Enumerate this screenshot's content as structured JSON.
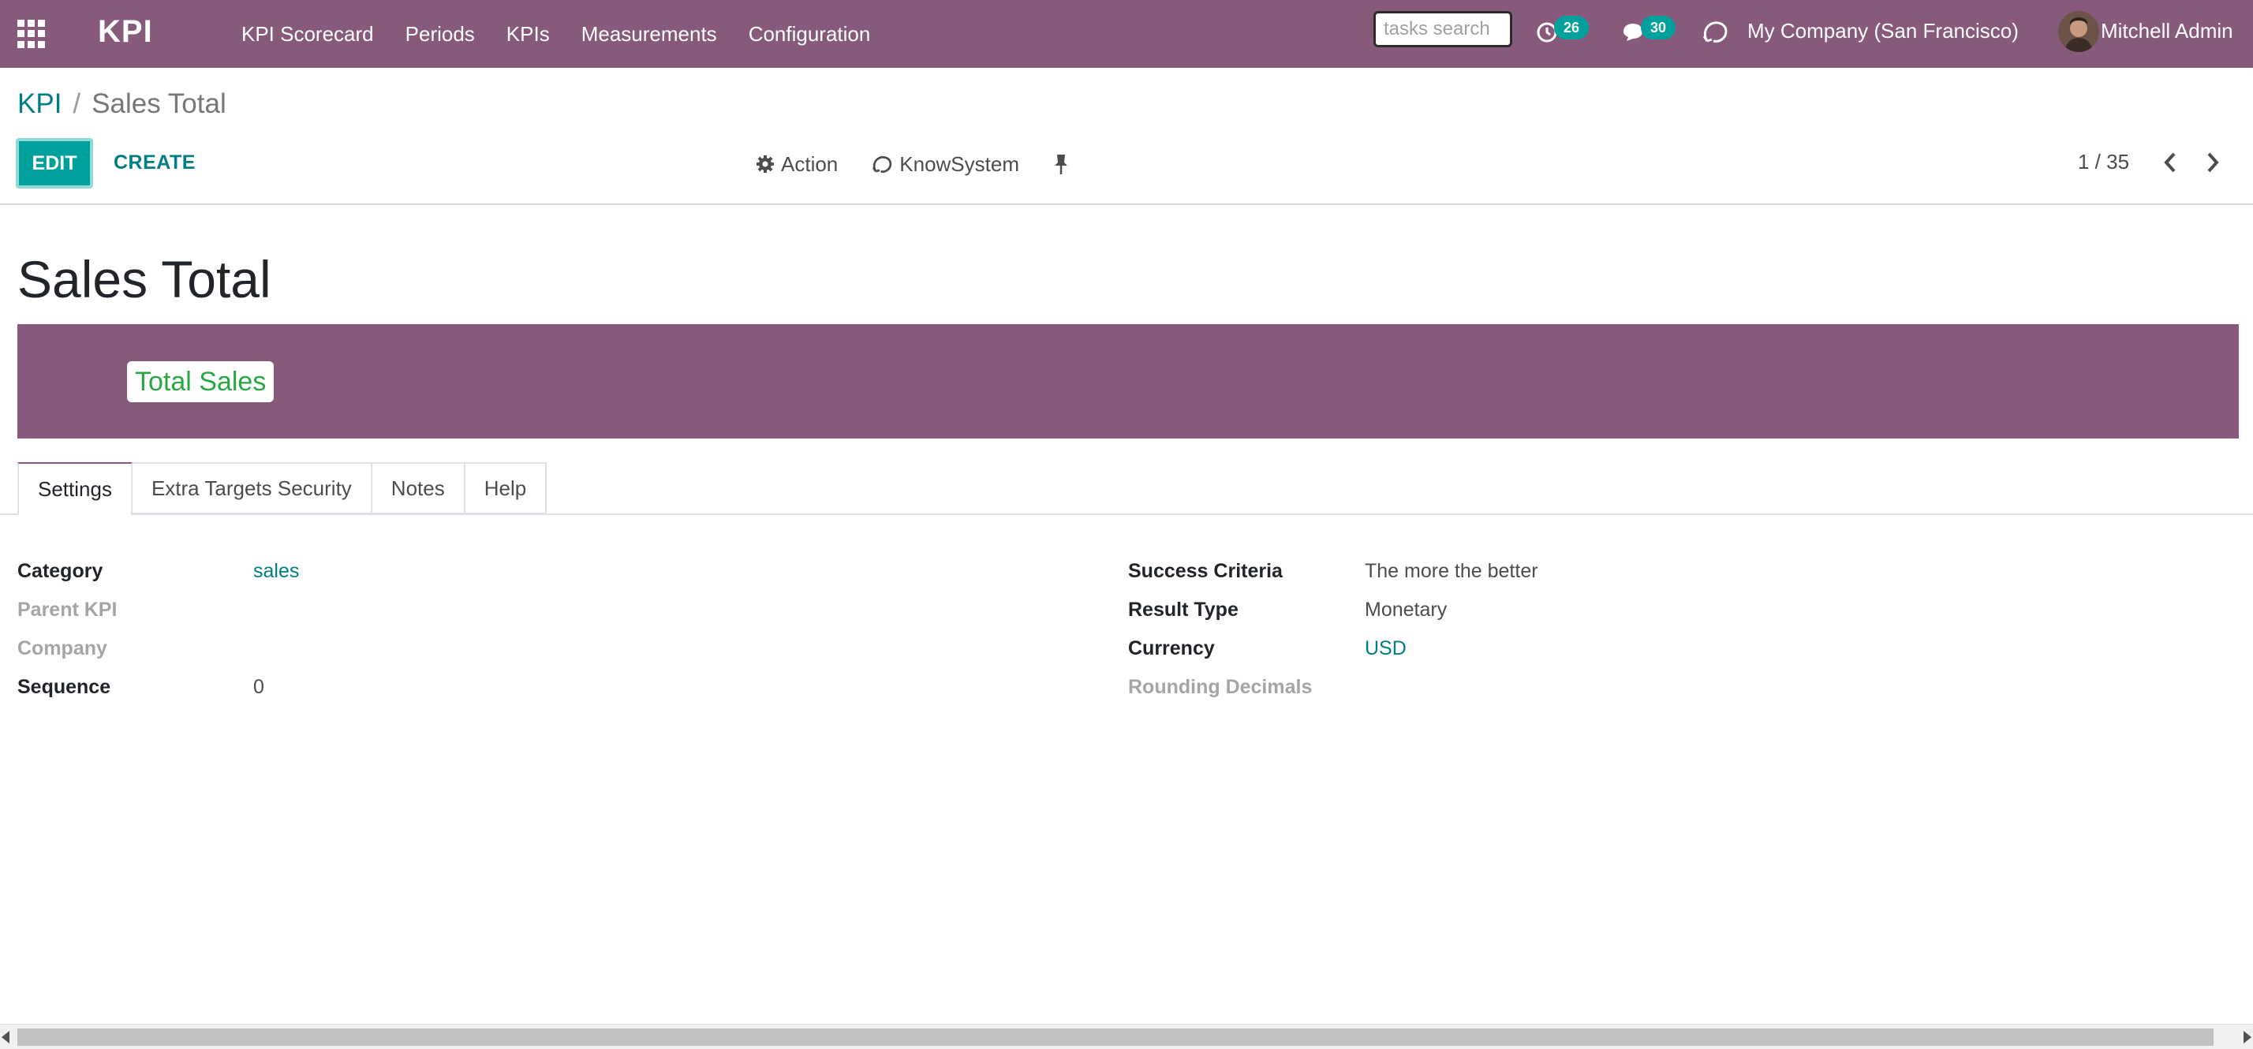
{
  "navbar": {
    "brand": "KPI",
    "menu": [
      "KPI Scorecard",
      "Periods",
      "KPIs",
      "Measurements",
      "Configuration"
    ],
    "tasks_search_placeholder": "tasks search",
    "activity_count": "26",
    "messages_count": "30",
    "company": "My Company (San Francisco)",
    "user": "Mitchell Admin",
    "icons": [
      "apps-grid-icon",
      "clock-icon",
      "chat-icon",
      "knowsystem-icon",
      "avatar"
    ],
    "colors": {
      "navbar": "#875a7b",
      "badge": "#00a09d"
    }
  },
  "breadcrumb": {
    "parent": "KPI",
    "separator": "/",
    "current": "Sales Total"
  },
  "control_panel": {
    "edit_label": "EDIT",
    "create_label": "CREATE",
    "action_label": "Action",
    "knowsystem_label": "KnowSystem",
    "pager": "1 / 35",
    "colors": {
      "primary": "#00a09d",
      "link": "#017e84"
    }
  },
  "form": {
    "title": "Sales Total",
    "banner_label": "Total Sales",
    "tabs": [
      "Settings",
      "Extra Targets Security",
      "Notes",
      "Help"
    ],
    "active_tab": "Settings",
    "left_fields": [
      {
        "label": "Category",
        "value": "sales"
      },
      {
        "label": "Parent KPI",
        "value": ""
      },
      {
        "label": "Company",
        "value": ""
      },
      {
        "label": "Sequence",
        "value": "0"
      }
    ],
    "right_fields": [
      {
        "label": "Success Criteria",
        "value": "The more the better"
      },
      {
        "label": "Result Type",
        "value": "Monetary"
      },
      {
        "label": "Currency",
        "value": "USD"
      },
      {
        "label": "Rounding Decimals",
        "value": ""
      }
    ]
  }
}
